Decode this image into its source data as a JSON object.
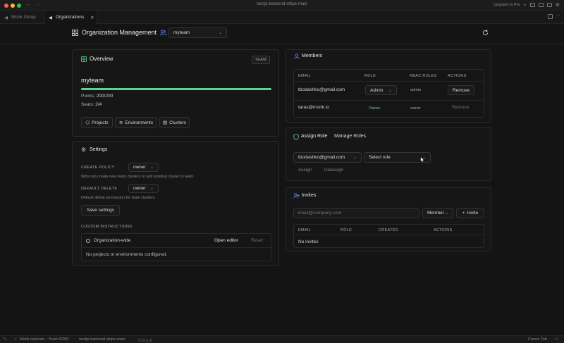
{
  "window": {
    "title": "nextjs-backend-stripe-main",
    "upgrade": "Upgrade to Pro"
  },
  "tabs": [
    {
      "label": "Monk Setup"
    },
    {
      "label": "Organizations"
    }
  ],
  "header": {
    "title": "Organization Management",
    "org_select": "myteam"
  },
  "overview": {
    "title": "Overview",
    "badge": "TEAM",
    "team_name": "myteam",
    "progress": 1.0,
    "points_label": "Points:",
    "points_value": "200/200",
    "seats_label": "Seats:",
    "seats_value": "2/4",
    "buttons": [
      "Projects",
      "Environments",
      "Clusters"
    ]
  },
  "settings": {
    "title": "Settings",
    "create_policy_label": "CREATE POLICY",
    "create_policy_value": "owner",
    "create_policy_help": "Who can create new team clusters or add existing cluster to team.",
    "default_delete_label": "DEFAULT DELETE",
    "default_delete_value": "owner",
    "default_delete_help": "Default delete permission for team clusters.",
    "save_label": "Save settings",
    "custom_instructions_label": "CUSTOM INSTRUCTIONS",
    "org_wide_label": "Organization-wide",
    "open_editor": "Open editor",
    "reset": "Reset",
    "empty_text": "No projects or environments configured."
  },
  "members": {
    "title": "Members",
    "columns": [
      "EMAIL",
      "ROLE",
      "RBAC ROLES",
      "ACTIONS"
    ],
    "rows": [
      {
        "email": "tbodashko@gmail.com",
        "role": "Admin",
        "rbac": "admin",
        "action": "Remove"
      },
      {
        "email": "taras@monk.io",
        "role": "Owner",
        "rbac": "owner",
        "action": "Remove"
      }
    ]
  },
  "assign_role": {
    "tab_assign": "Assign Role",
    "tab_manage": "Manage Roles",
    "member_select": "tbodashko@gmail.com",
    "role_select": "Select role",
    "assign": "Assign",
    "unassign": "Unassign"
  },
  "invites": {
    "title": "Invites",
    "email_placeholder": "email@company.com",
    "role_select": "Member",
    "invite_button": "Invite",
    "columns": [
      "EMAIL",
      "ROLE",
      "CREATED",
      "ACTIONS"
    ],
    "empty_text": "No invites"
  },
  "statusbar": {
    "monk": "Monk myteam – Team 0/200",
    "branch": "nextjs-backend-stripe-main",
    "problems": "0",
    "warnings": "0",
    "right": "Cursor Tab"
  },
  "colors": {
    "accent_green": "#5fd38d",
    "owner_green": "#5fd38d",
    "bg": "#141414"
  }
}
